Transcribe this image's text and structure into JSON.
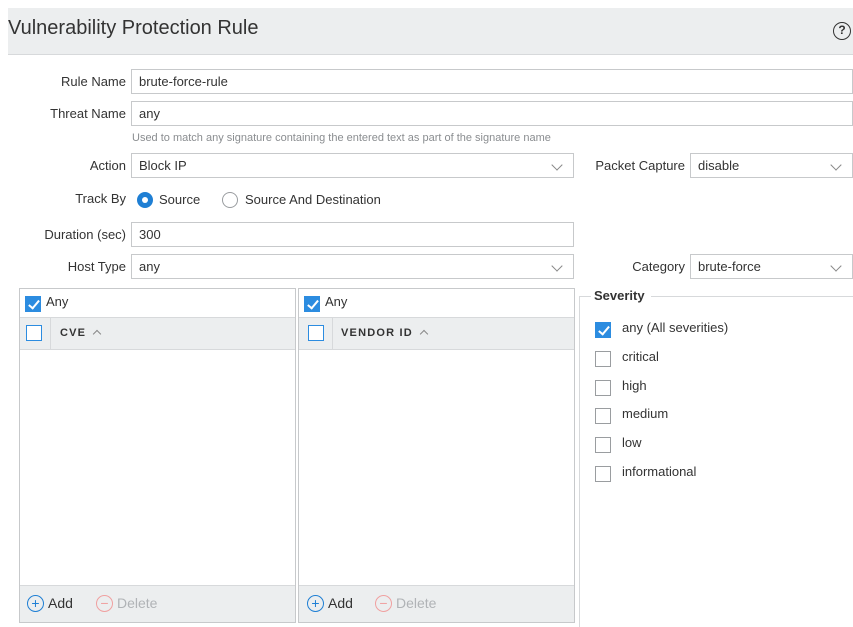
{
  "dialog": {
    "title": "Vulnerability Protection Rule",
    "help_icon": "?"
  },
  "form": {
    "rule_name": {
      "label": "Rule Name",
      "value": "brute-force-rule"
    },
    "threat_name": {
      "label": "Threat Name",
      "value": "any",
      "hint": "Used to match any signature containing the entered text as part of the signature name"
    },
    "action": {
      "label": "Action",
      "value": "Block IP"
    },
    "packet_capture": {
      "label": "Packet Capture",
      "value": "disable"
    },
    "track_by": {
      "label": "Track By",
      "options": [
        "Source",
        "Source And Destination"
      ],
      "selected": "Source"
    },
    "duration": {
      "label": "Duration (sec)",
      "value": "300"
    },
    "host_type": {
      "label": "Host Type",
      "value": "any"
    },
    "category": {
      "label": "Category",
      "value": "brute-force"
    }
  },
  "cve_grid": {
    "any_label": "Any",
    "any_checked": true,
    "column": "CVE",
    "add_label": "Add",
    "delete_label": "Delete"
  },
  "vendor_grid": {
    "any_label": "Any",
    "any_checked": true,
    "column": "VENDOR ID",
    "add_label": "Add",
    "delete_label": "Delete"
  },
  "severity": {
    "title": "Severity",
    "items": [
      {
        "label": "any (All severities)",
        "checked": true
      },
      {
        "label": "critical",
        "checked": false
      },
      {
        "label": "high",
        "checked": false
      },
      {
        "label": "medium",
        "checked": false
      },
      {
        "label": "low",
        "checked": false
      },
      {
        "label": "informational",
        "checked": false
      }
    ]
  },
  "colors": {
    "accent": "#1f7fd4",
    "header_bg": "#eceeef",
    "border": "#c7c9cb"
  }
}
